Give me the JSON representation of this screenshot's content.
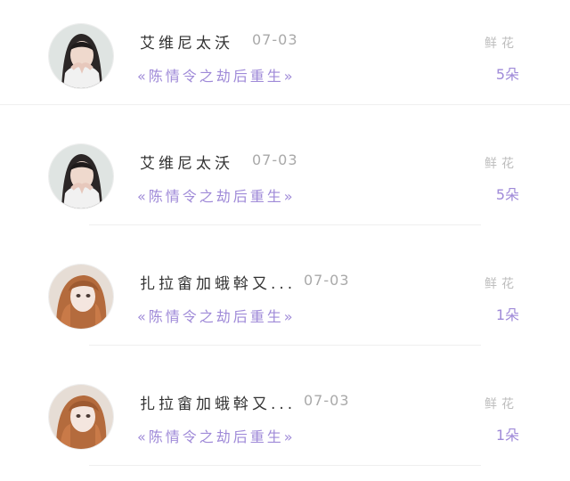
{
  "records": [
    {
      "avatar": "avatar-girl-dark-hair",
      "name": "艾维尼太沃",
      "date": "07-03",
      "title": "«陈情令之劫后重生»",
      "gift_label": "鲜花",
      "gift_count": "5朵"
    },
    {
      "avatar": "avatar-girl-dark-hair",
      "name": "艾维尼太沃",
      "date": "07-03",
      "title": "«陈情令之劫后重生»",
      "gift_label": "鲜花",
      "gift_count": "5朵"
    },
    {
      "avatar": "avatar-doll-auburn-hair",
      "name": "扎拉畲加蛾斡又...",
      "date": "07-03",
      "title": "«陈情令之劫后重生»",
      "gift_label": "鲜花",
      "gift_count": "1朵"
    },
    {
      "avatar": "avatar-doll-auburn-hair",
      "name": "扎拉畲加蛾斡又...",
      "date": "07-03",
      "title": "«陈情令之劫后重生»",
      "gift_label": "鲜花",
      "gift_count": "1朵"
    }
  ],
  "colors": {
    "accent": "#9f8ad8",
    "name_text": "#333333",
    "muted_text": "#a9a9a9",
    "divider": "#efefef"
  }
}
